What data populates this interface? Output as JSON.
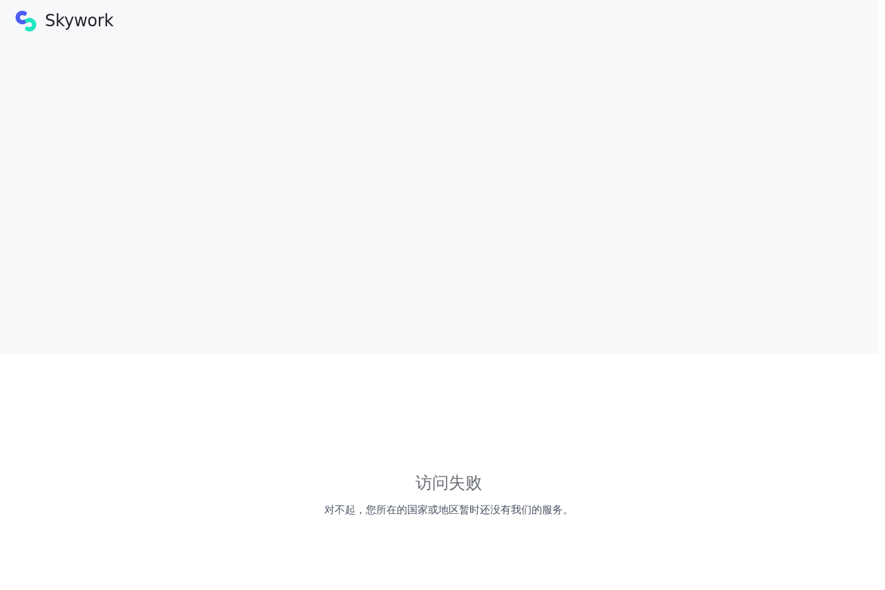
{
  "header": {
    "logo": {
      "text": "Skywork"
    }
  },
  "error": {
    "title": "访问失败",
    "message": "对不起，您所在的国家或地区暂时还没有我们的服务。"
  }
}
